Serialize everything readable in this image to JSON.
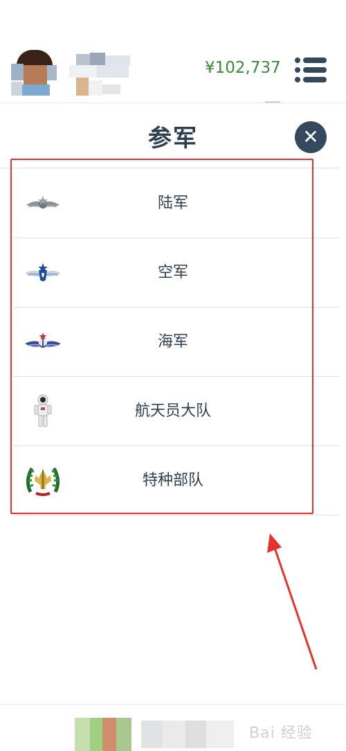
{
  "header": {
    "coins": "¥102,737"
  },
  "modal": {
    "title": "参军",
    "items": [
      {
        "label": "陆军",
        "icon": "army-emblem-icon"
      },
      {
        "label": "空军",
        "icon": "air-force-emblem-icon"
      },
      {
        "label": "海军",
        "icon": "navy-emblem-icon"
      },
      {
        "label": "航天员大队",
        "icon": "astronaut-icon"
      },
      {
        "label": "特种部队",
        "icon": "special-forces-emblem-icon"
      }
    ]
  },
  "colors": {
    "coins": "#3a8a3a",
    "title": "#2c3e50",
    "close_button": "#34495e",
    "highlight": "#e8302c"
  },
  "watermark": "Bai 经验"
}
